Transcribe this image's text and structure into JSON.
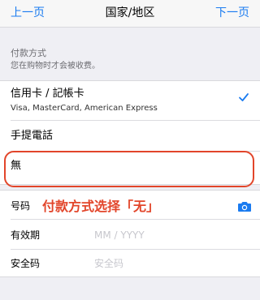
{
  "nav": {
    "back_label": "上一页",
    "title": "国家/地区",
    "next_label": "下一页"
  },
  "payment": {
    "header": "付款方式",
    "subheader": "您在购物时才会被收费。",
    "options": [
      {
        "title": "信用卡 / 記帳卡",
        "subtitle": "Visa, MasterCard, American Express",
        "selected": true
      },
      {
        "title": "手提電話",
        "selected": false
      },
      {
        "title": "無",
        "selected": false
      }
    ]
  },
  "card_form": {
    "number_label": "号码",
    "expiry_label": "有效期",
    "expiry_placeholder": "MM  /  YYYY",
    "security_label": "安全码",
    "security_placeholder": "安全码"
  },
  "annotation": {
    "text": "付款方式选择「无」",
    "color": "#e2452a"
  },
  "icons": {
    "check": "checkmark-icon",
    "camera": "camera-icon"
  },
  "colors": {
    "accent": "#1a7bf0",
    "highlight": "#e2452a",
    "background": "#efeff4"
  }
}
